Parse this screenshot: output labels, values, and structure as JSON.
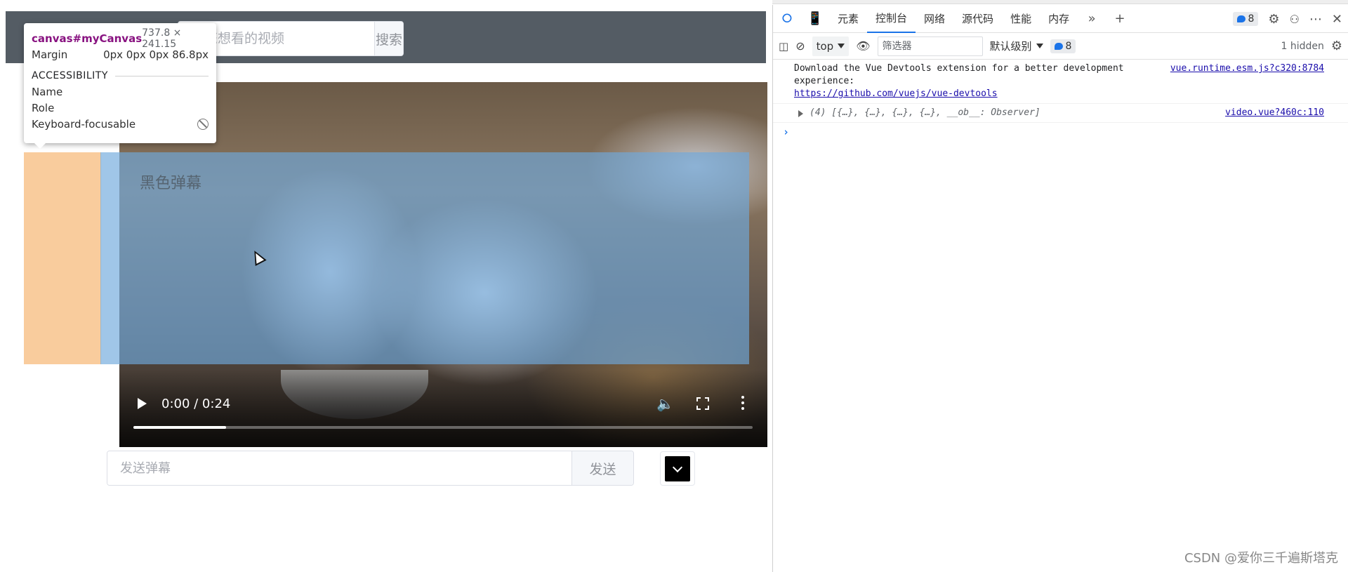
{
  "page": {
    "search": {
      "placeholder": "入您想看的视频",
      "button_label": "搜索"
    },
    "video": {
      "time": "0:00 / 0:24",
      "progress_fraction": 0.15,
      "danmu_text": "黑色弹幕"
    },
    "danmu_input": {
      "placeholder": "发送弹幕",
      "send_label": "发送",
      "color": "#000000"
    }
  },
  "tooltip": {
    "element": "canvas#myCanvas",
    "dimensions": "737.8 × 241.15",
    "margin_label": "Margin",
    "margin_value": "0px 0px 0px 86.8px",
    "section": "ACCESSIBILITY",
    "rows": [
      "Name",
      "Role",
      "Keyboard-focusable"
    ]
  },
  "devtools": {
    "tabs": [
      "元素",
      "控制台",
      "网络",
      "源代码",
      "性能",
      "内存"
    ],
    "active_tab": "控制台",
    "issues_count": "8",
    "context": "top",
    "filter_placeholder": "筛选器",
    "level": "默认级别",
    "level_badge": "8",
    "hidden": "1 hidden",
    "messages": [
      {
        "text": "Download the Vue Devtools extension for a better development experience:",
        "link": "https://github.com/vuejs/vue-devtools",
        "source": "vue.runtime.esm.js?c320:8784"
      },
      {
        "text": "(4) [{…}, {…}, {…}, {…}, __ob__: Observer]",
        "source": "video.vue?460c:110"
      }
    ]
  },
  "watermark": "CSDN @爱你三千遍斯塔克"
}
